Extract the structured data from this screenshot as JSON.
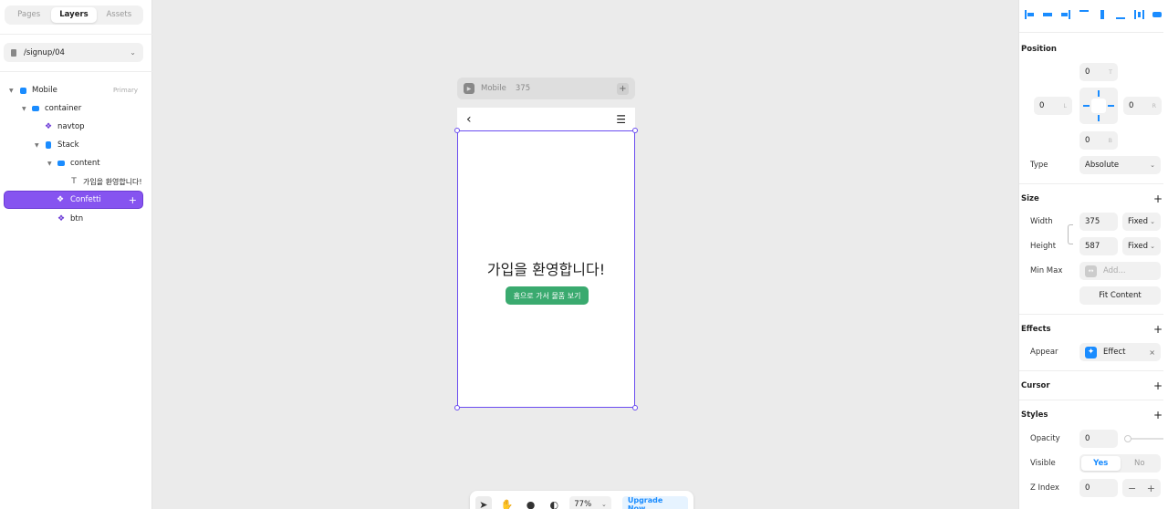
{
  "left_panel": {
    "tabs": [
      {
        "label": "Pages"
      },
      {
        "label": "Layers"
      },
      {
        "label": "Assets"
      }
    ],
    "page_path": "/signup/04",
    "layers": [
      {
        "label": "Mobile",
        "tag": "Primary"
      },
      {
        "label": "container"
      },
      {
        "label": "navtop"
      },
      {
        "label": "Stack"
      },
      {
        "label": "content"
      },
      {
        "label": "가입을 환영합니다!"
      },
      {
        "label": "Confetti"
      },
      {
        "label": "btn"
      }
    ]
  },
  "canvas": {
    "frame_name": "Mobile",
    "frame_width": "375",
    "welcome_text": "가입을 환영합니다!",
    "cta_label": "홈으로 가서 물품 보기"
  },
  "toolbar": {
    "zoom": "77%",
    "upgrade_label": "Upgrade Now"
  },
  "properties": {
    "position": {
      "title": "Position",
      "top": "0",
      "top_suffix": "T",
      "left": "0",
      "left_suffix": "L",
      "right": "0",
      "right_suffix": "R",
      "bottom": "0",
      "bottom_suffix": "B",
      "type_label": "Type",
      "type_value": "Absolute"
    },
    "size": {
      "title": "Size",
      "width_label": "Width",
      "width_value": "375",
      "width_mode": "Fixed",
      "height_label": "Height",
      "height_value": "587",
      "height_mode": "Fixed",
      "minmax_label": "Min Max",
      "minmax_placeholder": "Add...",
      "fit_label": "Fit Content"
    },
    "effects": {
      "title": "Effects",
      "appear_label": "Appear",
      "effect_value": "Effect"
    },
    "cursor": {
      "title": "Cursor"
    },
    "styles": {
      "title": "Styles",
      "opacity_label": "Opacity",
      "opacity_value": "0",
      "visible_label": "Visible",
      "visible_yes": "Yes",
      "visible_no": "No",
      "zindex_label": "Z Index",
      "zindex_value": "0"
    }
  },
  "colors": {
    "accent": "#1a8cff",
    "selection": "#8654f0",
    "cta_green": "#3aaa6f"
  }
}
